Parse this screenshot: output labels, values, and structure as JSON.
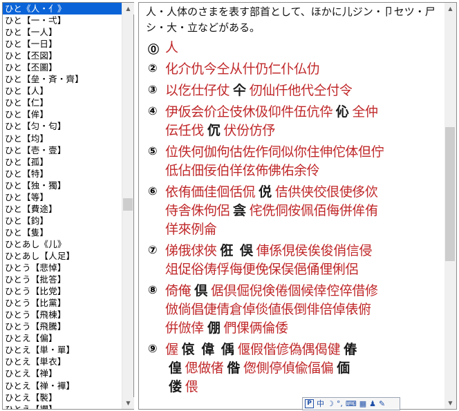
{
  "list": {
    "selected_index": 0,
    "items": [
      "ひと《人・亻》",
      "ひと【一・弌】",
      "ひと【一人】",
      "ひと【一日】",
      "ひと【丕図】",
      "ひと【丕圖】",
      "ひと【垒・斉・齊】",
      "ひと【人】",
      "ひと【仁】",
      "ひと【侔】",
      "ひと【匀・匂】",
      "ひと【均】",
      "ひと【壱・壹】",
      "ひと【孤】",
      "ひと【特】",
      "ひと【独・獨】",
      "ひと【等】",
      "ひと【費途】",
      "ひと【鈞】",
      "ひと【隻】",
      "ひとあし《儿》",
      "ひとあし【人足】",
      "ひとう【悲悼】",
      "ひとう【批答】",
      "ひとう【比党】",
      "ひとう【比黨】",
      "ひとう【飛棟】",
      "ひとう【飛騰】",
      "ひとえ【偏】",
      "ひとえ【単・單】",
      "ひとえ【単衣】",
      "ひとえ【禅】",
      "ひとえ【禅・襌】",
      "ひとえ【褧】",
      "ひとえ【襴】"
    ]
  },
  "content": {
    "intro": "人・人体のさまを表す部首として、ほかに儿ジン・卩セツ・尸シ・大・立などがある。",
    "sections": [
      {
        "num": "⓪",
        "lines": [
          [
            [
              "人",
              "r"
            ]
          ]
        ]
      },
      {
        "num": "②",
        "lines": [
          [
            [
              "化介仇今仝从什仍仁仆仏仂",
              "r"
            ]
          ]
        ]
      },
      {
        "num": "③",
        "lines": [
          [
            [
              "以仡仕仔仗",
              "r"
            ],
            [
              "仐",
              "g"
            ],
            [
              "仞仙仟他代仝付令",
              "r"
            ]
          ]
        ]
      },
      {
        "num": "④",
        "lines": [
          [
            [
              "伊仮会价企伎休伋仰件伍伉伜",
              "r"
            ],
            [
              "伈",
              "g"
            ],
            [
              "全仲",
              "r"
            ]
          ],
          [
            [
              "伝任伐",
              "r"
            ],
            [
              "伔",
              "g"
            ],
            [
              "伏份仿伃",
              "r"
            ]
          ]
        ]
      },
      {
        "num": "⑤",
        "lines": [
          [
            [
              "位佚何伽佝估佐作伺似你住伸佗体但佇",
              "r"
            ]
          ],
          [
            [
              "低佔佃佞伯佯伭佈佛佑余伶",
              "r"
            ]
          ]
        ]
      },
      {
        "num": "⑥",
        "lines": [
          [
            [
              "依侑価佳佪佸侃",
              "r"
            ],
            [
              "侻",
              "g"
            ],
            [
              "佶供侠佼佷使侈佽",
              "r"
            ]
          ],
          [
            [
              "侍舎侏佝侶",
              "r"
            ],
            [
              "侌",
              "g"
            ],
            [
              "侘侁侗侒佩佰侮併侔侑",
              "r"
            ]
          ],
          [
            [
              "佯來例侖",
              "r"
            ]
          ]
        ]
      },
      {
        "num": "⑦",
        "lines": [
          [
            [
              "俤俄俅俠",
              "r"
            ],
            [
              "俇",
              "g"
            ],
            [
              "俁",
              "g"
            ],
            [
              "俥係俔侯俟俊俏信侵",
              "r"
            ]
          ],
          [
            [
              "俎促俗俦俘侮便俛保俣俋俑俚俐侶",
              "r"
            ]
          ]
        ]
      },
      {
        "num": "⑧",
        "lines": [
          [
            [
              "倚俺",
              "r"
            ],
            [
              "倶",
              "g"
            ],
            [
              "倨倶倔倪倹倦個候倖倥倅借修",
              "r"
            ]
          ],
          [
            [
              "倣倘倡倢倩倉倬倓値倀倒俳倍倬俵俯",
              "r"
            ]
          ],
          [
            [
              "倂倣倖",
              "r"
            ],
            [
              "倗",
              "g"
            ],
            [
              "們倮俩倫倭",
              "r"
            ]
          ]
        ]
      },
      {
        "num": "⑨",
        "lines": [
          [
            [
              "偓",
              "r"
            ],
            [
              "偯",
              "g"
            ],
            [
              "偉",
              "g"
            ],
            [
              "偊",
              "g"
            ],
            [
              "偃假偕偐偽偶偈健",
              "r"
            ],
            [
              "偆",
              "g"
            ]
          ],
          [
            [
              "偟",
              "g"
            ],
            [
              "偲做偖",
              "r"
            ],
            [
              "偺",
              "g"
            ],
            [
              "偬側停偵偸偪偏",
              "r"
            ],
            [
              "偭",
              "g"
            ]
          ],
          [
            [
              "偻",
              "g"
            ],
            [
              "偎",
              "r"
            ]
          ]
        ]
      }
    ]
  },
  "ime": {
    "logo": "P",
    "mode": "中",
    "items": [
      "☽",
      "°,",
      "⌨",
      "▦",
      "♟",
      "✎"
    ]
  }
}
